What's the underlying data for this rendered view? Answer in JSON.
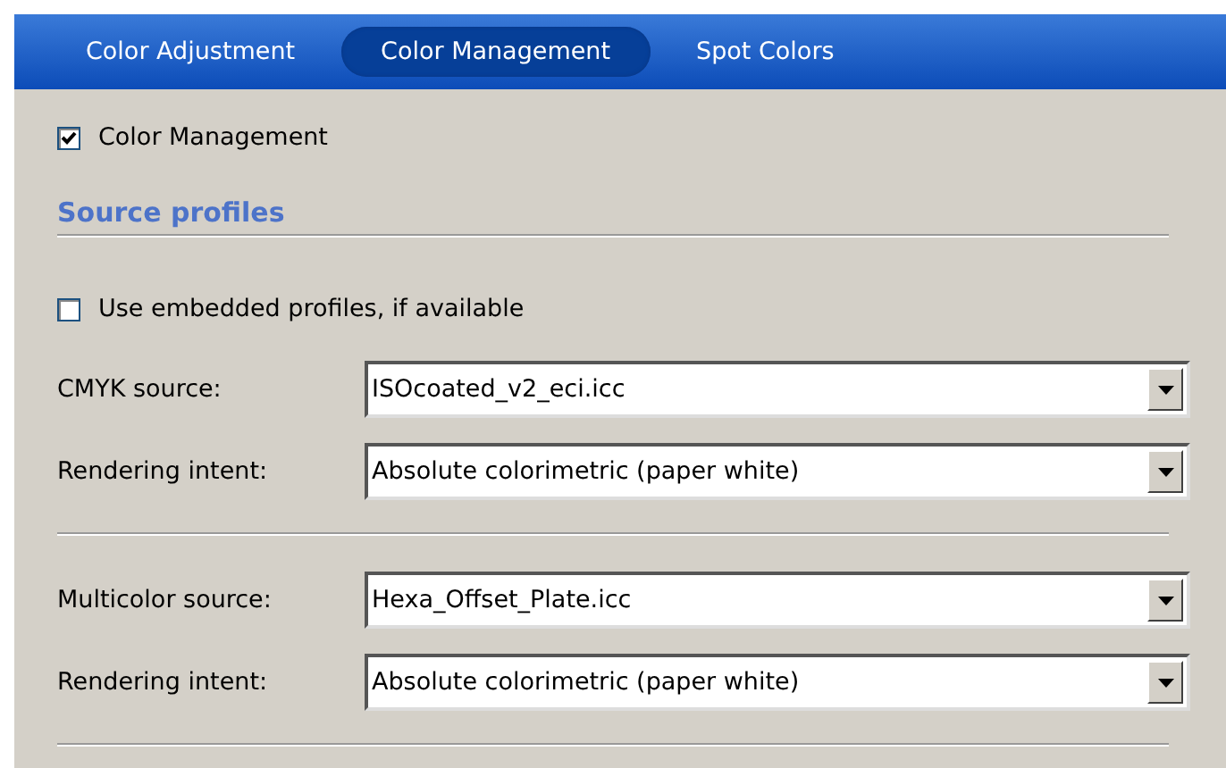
{
  "tabs": [
    {
      "label": "Color Adjustment",
      "selected": false
    },
    {
      "label": "Color Management",
      "selected": true
    },
    {
      "label": "Spot Colors",
      "selected": false
    }
  ],
  "color_management": {
    "label": "Color Management",
    "checked": true
  },
  "section": {
    "title": "Source profiles"
  },
  "use_embedded": {
    "label": "Use embedded profiles, if available",
    "checked": false
  },
  "groups": [
    {
      "fields": [
        {
          "label": "CMYK source:",
          "value": "ISOcoated_v2_eci.icc"
        },
        {
          "label": "Rendering intent:",
          "value": "Absolute colorimetric (paper white)"
        }
      ]
    },
    {
      "fields": [
        {
          "label": "Multicolor source:",
          "value": "Hexa_Offset_Plate.icc"
        },
        {
          "label": "Rendering intent:",
          "value": "Absolute colorimetric (paper white)"
        }
      ]
    }
  ]
}
